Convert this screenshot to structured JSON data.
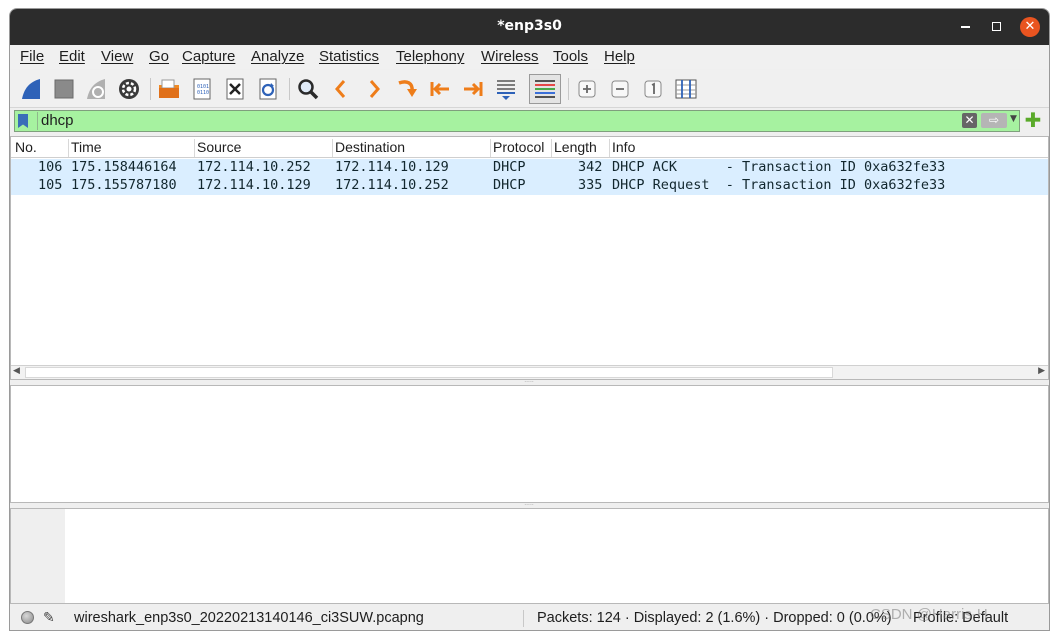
{
  "window": {
    "title": "*enp3s0",
    "close_glyph": "✕"
  },
  "menu": [
    {
      "label": "File"
    },
    {
      "label": "Edit"
    },
    {
      "label": "View"
    },
    {
      "label": "Go"
    },
    {
      "label": "Capture"
    },
    {
      "label": "Analyze"
    },
    {
      "label": "Statistics"
    },
    {
      "label": "Telephony"
    },
    {
      "label": "Wireless"
    },
    {
      "label": "Tools"
    },
    {
      "label": "Help"
    }
  ],
  "toolbar": {
    "icons": [
      "start-capture-icon",
      "stop-capture-icon",
      "restart-capture-icon",
      "capture-options-icon",
      "open-file-icon",
      "save-file-icon",
      "close-file-icon",
      "reload-file-icon",
      "find-packet-icon",
      "go-back-icon",
      "go-forward-icon",
      "go-to-packet-icon",
      "first-packet-icon",
      "last-packet-icon",
      "autoscroll-icon",
      "colorize-icon",
      "zoom-in-icon",
      "zoom-out-icon",
      "normal-size-icon",
      "resize-columns-icon"
    ]
  },
  "filter": {
    "value": "dhcp",
    "bg_color": "#a6f2a0",
    "add_glyph": "✚",
    "clear_glyph": "✕",
    "apply_glyph": "⇨",
    "dropdown_glyph": "▼"
  },
  "packet_list": {
    "columns": [
      "No.",
      "Time",
      "Source",
      "Destination",
      "Protocol",
      "Length",
      "Info"
    ],
    "rows": [
      {
        "no": "106",
        "time": "175.158446164",
        "source": "172.114.10.252",
        "destination": "172.114.10.129",
        "protocol": "DHCP",
        "length": "342",
        "info": "DHCP ACK      - Transaction ID 0xa632fe33"
      },
      {
        "no": "105",
        "time": "175.155787180",
        "source": "172.114.10.129",
        "destination": "172.114.10.252",
        "protocol": "DHCP",
        "length": "335",
        "info": "DHCP Request  - Transaction ID 0xa632fe33"
      }
    ],
    "row_color": "#daeeff",
    "scroll_left": "◀",
    "scroll_right": "▶"
  },
  "splitter_glyph": "·····",
  "status": {
    "file": "wireshark_enp3s0_20220213140146_ci3SUW.pcapng",
    "stats": "Packets: 124 · Displayed: 2 (1.6%) · Dropped: 0 (0.0%)",
    "profile": "Profile: Default",
    "note_glyph": "✎"
  },
  "watermark": "CSDN @Harris-H",
  "colors": {
    "accent_close": "#e95420",
    "titlebar": "#2c2c2c"
  }
}
